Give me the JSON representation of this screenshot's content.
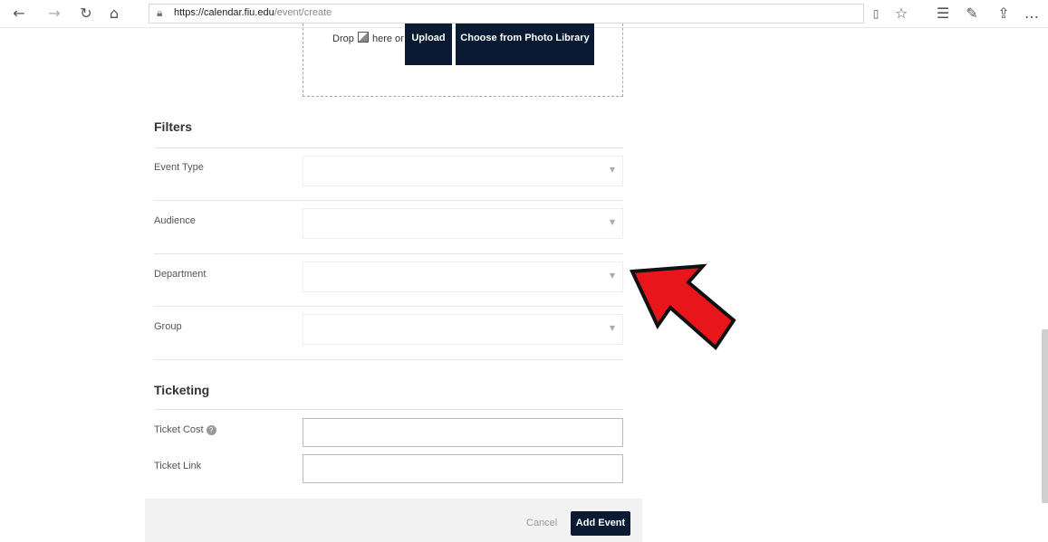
{
  "browser": {
    "url_host": "https://calendar.fiu.edu",
    "url_path": "/event/create",
    "icons": [
      "back-icon",
      "forward-icon",
      "refresh-icon",
      "home-icon",
      "lock-icon",
      "reading-view-icon",
      "favorite-star-icon",
      "favorites-list-icon",
      "pen-icon",
      "share-icon",
      "more-icon"
    ]
  },
  "upload": {
    "drop_prefix": "Drop",
    "drop_suffix": "here or",
    "upload_label": "Upload",
    "library_label": "Choose from Photo Library"
  },
  "filters": {
    "title": "Filters",
    "fields": [
      {
        "label": "Event Type"
      },
      {
        "label": "Audience"
      },
      {
        "label": "Department"
      },
      {
        "label": "Group"
      }
    ]
  },
  "ticketing": {
    "title": "Ticketing",
    "cost_label": "Ticket Cost",
    "link_label": "Ticket Link"
  },
  "actions": {
    "cancel_label": "Cancel",
    "add_label": "Add Event"
  },
  "annotation": {
    "arrow_color": "#e8161b"
  },
  "colors": {
    "button_bg": "#0a1a33"
  }
}
